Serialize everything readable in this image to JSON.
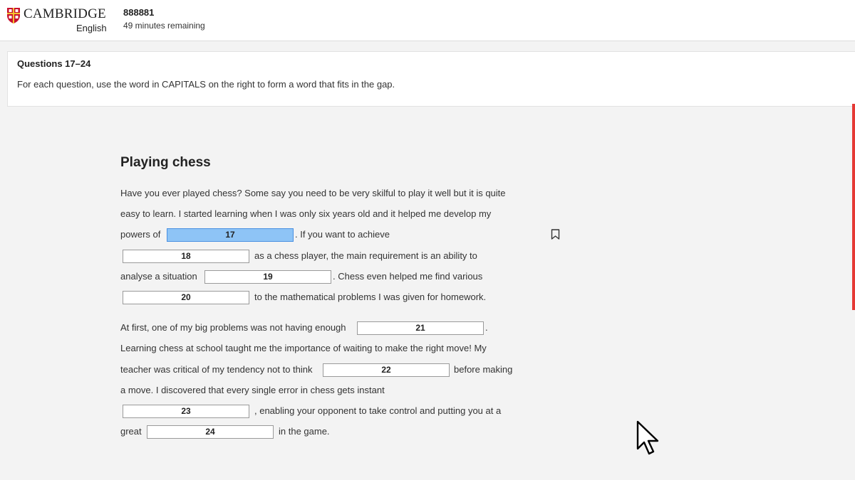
{
  "header": {
    "brand_name": "CAMBRIDGE",
    "brand_sub": "English",
    "candidate_id": "888881",
    "time_remaining": "49 minutes remaining"
  },
  "instructions": {
    "range": "Questions 17–24",
    "text": "For each question, use the word in CAPITALS on the right to form a word that fits in the gap."
  },
  "passage": {
    "title": "Playing chess",
    "t1": "Have you ever played chess? Some say you need to be very skilful to play it well but it is quite",
    "t2": "easy to learn. I started learning when I was only six years old and it helped me develop my",
    "t3a": "powers of",
    "t3b": ". If you want to achieve",
    "t4": "as a chess player, the main requirement is an ability to",
    "t5a": "analyse a situation",
    "t5b": ". Chess even helped me find various",
    "t6": "to the mathematical problems I was given for homework.",
    "t7a": "At first, one of my big problems was not having enough",
    "t7b": ".",
    "t8": "Learning chess at school taught me the importance of waiting to make the right move! My",
    "t9a": "teacher was critical of my tendency not to think",
    "t9b": "before making",
    "t10": "a move. I discovered that every single error in chess gets instant",
    "t11": ", enabling your opponent to take control and putting you at a",
    "t12a": "great",
    "t12b": "in the game.",
    "gaps": [
      "17",
      "18",
      "19",
      "20",
      "21",
      "22",
      "23",
      "24"
    ]
  },
  "icons": {
    "bookmark": "bookmark-icon",
    "cursor": "mouse-pointer-icon"
  },
  "colors": {
    "active_gap": "#8ec4f6",
    "accent_red": "#e53935",
    "shield_red": "#c8102e"
  }
}
